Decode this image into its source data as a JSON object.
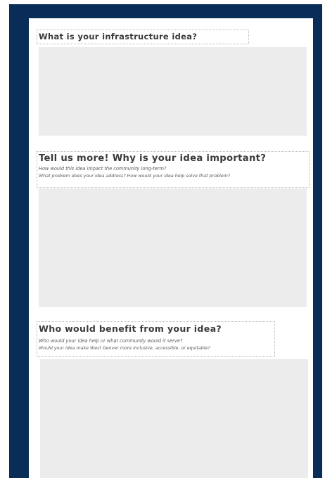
{
  "questions": [
    {
      "title": "What is your infrastructure idea?",
      "prompts": []
    },
    {
      "title": "Tell us more! Why is your idea important?",
      "prompts": [
        "How would this idea impact the community long-term?",
        "What problem does your idea address? How would your idea help solve that problem?"
      ]
    },
    {
      "title": "Who would benefit from your idea?",
      "prompts": [
        "Who would your idea help or what community would it serve?",
        "Would your idea make West Denver more inclusive, accessible, or equitable?"
      ]
    }
  ],
  "colors": {
    "frame": "#0a2d57",
    "answer_area": "#ececec",
    "title_text": "#3a3a3a"
  }
}
